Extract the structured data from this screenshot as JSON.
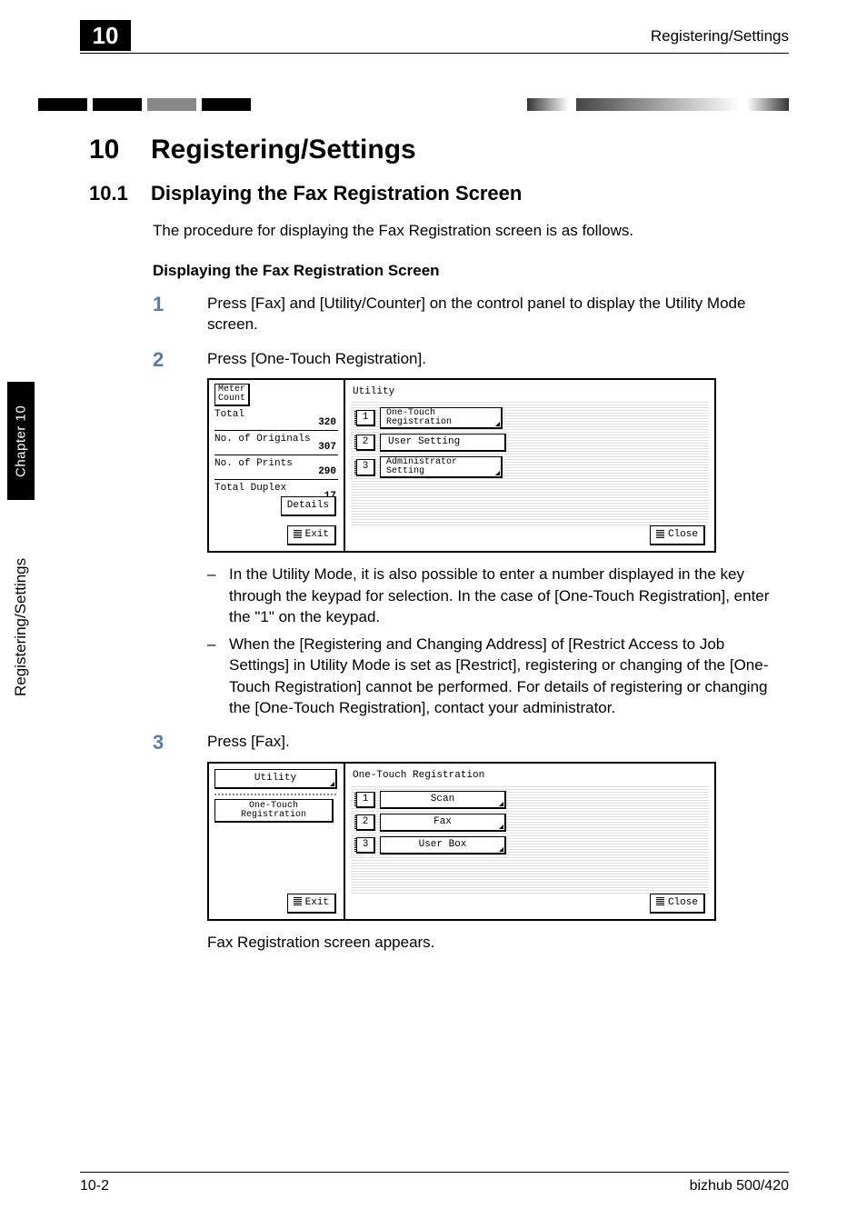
{
  "header": {
    "chapter_tab": "10",
    "running_head": "Registering/Settings"
  },
  "side": {
    "chapter_label": "Chapter 10",
    "chapter_text": "Registering/Settings"
  },
  "title": {
    "chapnum": "10",
    "heading": "Registering/Settings"
  },
  "section": {
    "num": "10.1",
    "heading": "Displaying the Fax Registration Screen",
    "intro": "The procedure for displaying the Fax Registration screen is as follows.",
    "sub_heading": "Displaying the Fax Registration Screen"
  },
  "steps": {
    "s1": {
      "num": "1",
      "text": "Press [Fax] and [Utility/Counter] on the control panel to display the Utility Mode screen."
    },
    "s2": {
      "num": "2",
      "text": "Press [One-Touch Registration]."
    },
    "s2_notes": {
      "a": "In the Utility Mode, it is also possible to enter a number displayed in the key through the keypad for selection. In the case of [One-Touch Registration], enter the \"1\" on the keypad.",
      "b": "When the [Registering and Changing Address] of [Restrict Access to Job Settings] in Utility Mode is set as [Restrict], registering or changing of the [One-Touch Registration] cannot be performed. For details of registering or changing the [One-Touch Registration], contact your administrator."
    },
    "s3": {
      "num": "3",
      "text": "Press [Fax]."
    },
    "s3_after": "Fax Registration screen appears."
  },
  "screen1": {
    "meter_btn": "Meter\nCount",
    "rows": {
      "total": {
        "label": "Total",
        "value": "320"
      },
      "originals": {
        "label": "No. of Originals",
        "value": "307"
      },
      "prints": {
        "label": "No. of Prints",
        "value": "290"
      },
      "duplex": {
        "label": "Total Duplex",
        "value": "17"
      }
    },
    "details": "Details",
    "exit": "Exit",
    "title": "Utility",
    "menu": {
      "m1": {
        "num": "1",
        "label": "One-Touch\nRegistration"
      },
      "m2": {
        "num": "2",
        "label": "User Setting"
      },
      "m3": {
        "num": "3",
        "label": "Administrator\nSetting"
      }
    },
    "close": "Close"
  },
  "screen2": {
    "nav1": "Utility",
    "nav2": "One-Touch\nRegistration",
    "exit": "Exit",
    "title": "One-Touch Registration",
    "menu": {
      "m1": {
        "num": "1",
        "label": "Scan"
      },
      "m2": {
        "num": "2",
        "label": "Fax"
      },
      "m3": {
        "num": "3",
        "label": "User Box"
      }
    },
    "close": "Close"
  },
  "footer": {
    "page": "10-2",
    "model": "bizhub 500/420"
  }
}
